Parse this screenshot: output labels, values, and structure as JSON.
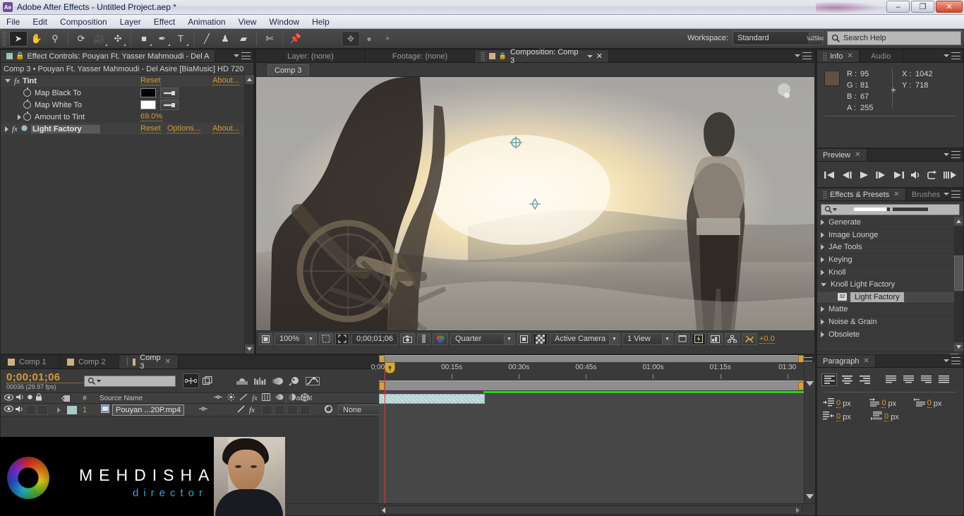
{
  "window": {
    "app_icon": "Ae",
    "title": "Adobe After Effects - Untitled Project.aep *",
    "minimize": "–",
    "restore": "❐",
    "close": "✕"
  },
  "menubar": {
    "items": [
      "File",
      "Edit",
      "Composition",
      "Layer",
      "Effect",
      "Animation",
      "View",
      "Window",
      "Help"
    ]
  },
  "toolbar": {
    "tools": [
      {
        "name": "selection-tool",
        "glyph": "➤",
        "selected": true
      },
      {
        "name": "hand-tool",
        "glyph": "✋",
        "selected": false
      },
      {
        "name": "zoom-tool",
        "glyph": "⚲",
        "selected": false
      },
      {
        "name": "rotation-tool",
        "glyph": "⟳",
        "selected": false
      },
      {
        "name": "camera-tool",
        "glyph": "🎥",
        "selected": false
      },
      {
        "name": "pan-behind-tool",
        "glyph": "✣",
        "selected": false
      },
      {
        "name": "rectangle-tool",
        "glyph": "■",
        "selected": false
      },
      {
        "name": "pen-tool",
        "glyph": "✒",
        "selected": false
      },
      {
        "name": "type-tool",
        "glyph": "T",
        "selected": false
      },
      {
        "name": "brush-tool",
        "glyph": "╱",
        "selected": false
      },
      {
        "name": "clone-stamp-tool",
        "glyph": "♟",
        "selected": false
      },
      {
        "name": "eraser-tool",
        "glyph": "▰",
        "selected": false
      },
      {
        "name": "roto-brush-tool",
        "glyph": "✄",
        "selected": false
      },
      {
        "name": "puppet-pin-tool",
        "glyph": "📌",
        "selected": false
      }
    ],
    "extras": [
      {
        "name": "transform-icon",
        "glyph": "✥"
      },
      {
        "name": "snapping-dot-icon",
        "glyph": "●"
      },
      {
        "name": "snapping-icon",
        "glyph": "⌖"
      }
    ],
    "workspace_label": "Workspace:",
    "workspace_value": "Standard",
    "search_help_placeholder": "Search Help",
    "search_icon": "search-icon"
  },
  "effect_controls": {
    "tab_title": "Effect Controls: Pouyan Ft. Yasser Mahmoudi -  Del A",
    "breadcrumb": "Comp 3 • Pouyan Ft. Yasser Mahmoudi -  Del Asire [BiaMusic] HD 720",
    "effects": [
      {
        "name": "Tint",
        "reset": "Reset",
        "about": "About...",
        "expanded": true,
        "properties": [
          {
            "label": "Map Black To",
            "type": "color",
            "color": "#000000"
          },
          {
            "label": "Map White To",
            "type": "color",
            "color": "#ffffff"
          },
          {
            "label": "Amount to Tint",
            "type": "value",
            "value": "69.0%"
          }
        ]
      },
      {
        "name": "Light Factory",
        "reset": "Reset",
        "options": "Options...",
        "about": "About...",
        "expanded": false,
        "properties": []
      }
    ]
  },
  "composition": {
    "tabs": [
      {
        "label": "Composition: Comp 3",
        "active": true
      },
      {
        "label": "Footage: (none)",
        "active": false
      },
      {
        "label": "Layer: (none)",
        "active": false
      }
    ],
    "subtab": "Comp 3",
    "viewer_controls": {
      "magnification": "100%",
      "timecode": "0;00;01;06",
      "resolution": "Quarter",
      "view_camera": "Active Camera",
      "view_layout": "1 View",
      "exposure": "+0.0",
      "region_of_interest_icon": "region-of-interest-icon",
      "grid_icon": "grid-guides-icon",
      "mask_icon": "mask-visibility-icon",
      "snapshot_icon": "snapshot-icon",
      "show_snapshot_icon": "show-snapshot-icon",
      "channel_icon": "channels-icon",
      "transparency_icon": "transparency-grid-icon",
      "fast_preview_icon": "fast-preview-icon",
      "timeline_icon": "timeline-icon",
      "flowchart_icon": "flowchart-icon",
      "reset_exposure_icon": "reset-exposure-icon"
    }
  },
  "info_panel": {
    "tabs": [
      {
        "label": "Info",
        "active": true
      },
      {
        "label": "Audio",
        "active": false
      }
    ],
    "swatch_color": "#5f5143",
    "channels": [
      {
        "label": "R :",
        "value": "95"
      },
      {
        "label": "G :",
        "value": "81"
      },
      {
        "label": "B :",
        "value": "67"
      },
      {
        "label": "A :",
        "value": "255"
      }
    ],
    "coords": [
      {
        "label": "X :",
        "value": "1042"
      },
      {
        "label": "Y :",
        "value": "718"
      }
    ]
  },
  "preview_panel": {
    "tab": "Preview",
    "buttons": [
      {
        "name": "first-frame-button",
        "glyph": "⏮"
      },
      {
        "name": "previous-frame-button",
        "glyph": "◀❘"
      },
      {
        "name": "play-button",
        "glyph": "▶"
      },
      {
        "name": "next-frame-button",
        "glyph": "❘▶"
      },
      {
        "name": "last-frame-button",
        "glyph": "⏭"
      },
      {
        "name": "audio-toggle-button",
        "glyph": "🔊"
      },
      {
        "name": "loop-button",
        "glyph": "↺"
      },
      {
        "name": "ram-preview-button",
        "glyph": "⦀▶"
      }
    ]
  },
  "effects_presets": {
    "tabs": [
      {
        "label": "Effects & Presets",
        "active": true
      },
      {
        "label": "Brushes",
        "active": false
      }
    ],
    "search_value": "",
    "search_icon": "search-icon",
    "rows": [
      {
        "label": "Generate",
        "expanded": false,
        "indent": 0,
        "selected": false
      },
      {
        "label": "Image Lounge",
        "expanded": false,
        "indent": 0,
        "selected": false
      },
      {
        "label": "JAe Tools",
        "expanded": false,
        "indent": 0,
        "selected": false
      },
      {
        "label": "Keying",
        "expanded": false,
        "indent": 0,
        "selected": false
      },
      {
        "label": "Knoll",
        "expanded": false,
        "indent": 0,
        "selected": false
      },
      {
        "label": "Knoll Light Factory",
        "expanded": true,
        "indent": 0,
        "selected": false
      },
      {
        "label": "Light Factory",
        "expanded": null,
        "indent": 1,
        "selected": true,
        "badge": "32"
      },
      {
        "label": "Matte",
        "expanded": false,
        "indent": 0,
        "selected": false
      },
      {
        "label": "Noise & Grain",
        "expanded": false,
        "indent": 0,
        "selected": false
      },
      {
        "label": "Obsolete",
        "expanded": false,
        "indent": 0,
        "selected": false
      }
    ]
  },
  "paragraph_panel": {
    "tab": "Paragraph",
    "align_buttons": [
      {
        "name": "align-left-button",
        "selected": true
      },
      {
        "name": "align-center-button",
        "selected": false
      },
      {
        "name": "align-right-button",
        "selected": false
      },
      {
        "name": "justify-last-left-button",
        "selected": false
      },
      {
        "name": "justify-last-center-button",
        "selected": false
      },
      {
        "name": "justify-last-right-button",
        "selected": false
      },
      {
        "name": "justify-all-button",
        "selected": false
      }
    ],
    "fields": [
      {
        "name": "indent-left-margin",
        "value": "0",
        "unit": "px"
      },
      {
        "name": "indent-right-margin",
        "value": "0",
        "unit": "px"
      },
      {
        "name": "indent-first-line",
        "value": "0",
        "unit": "px"
      },
      {
        "name": "space-before-paragraph",
        "value": "0",
        "unit": "px"
      },
      {
        "name": "space-after-paragraph",
        "value": "0",
        "unit": "px"
      }
    ]
  },
  "timeline": {
    "tabs": [
      {
        "label": "Comp 1",
        "active": false
      },
      {
        "label": "Comp 2",
        "active": false
      },
      {
        "label": "Comp 3",
        "active": true
      }
    ],
    "current_time": "0;00;01;06",
    "frame_info": "00036 (29.97 fps)",
    "search_value": "",
    "column_headers": {
      "eye": "video-toggle-icon",
      "audio": "audio-toggle-icon",
      "solo": "solo-toggle-icon",
      "lock": "lock-toggle-icon",
      "label": "label-color-icon",
      "number": "#",
      "source_name": "Source Name",
      "parent": "Parent",
      "switches": [
        "shy-icon",
        "collapse-icon",
        "quality-icon",
        "fx-icon",
        "frame-blend-icon",
        "motion-blur-icon",
        "adjustment-icon",
        "3d-layer-icon"
      ]
    },
    "layers": [
      {
        "index": "1",
        "source_name": "Pouyan ...20P.mp4",
        "label_color": "#a8ccc8",
        "parent": "None",
        "visible": true,
        "audio": true,
        "clip_start_pct": 0,
        "clip_width_pct": 25
      }
    ],
    "ruler_labels": [
      "00:15s",
      "00:30s",
      "00:45s",
      "01:00s",
      "01:15s",
      "01:30"
    ],
    "toolbar_icons": [
      "composition-mini-flowchart-icon",
      "draft-3d-icon",
      "hide-shy-layers-icon",
      "frame-blending-icon",
      "motion-blur-icon",
      "brainstorm-icon",
      "graph-editor-icon"
    ]
  },
  "watermark": {
    "name": "MEHDISHAFIE",
    "subtitle": "director",
    "logo_icon": "aperture-logo-icon"
  }
}
